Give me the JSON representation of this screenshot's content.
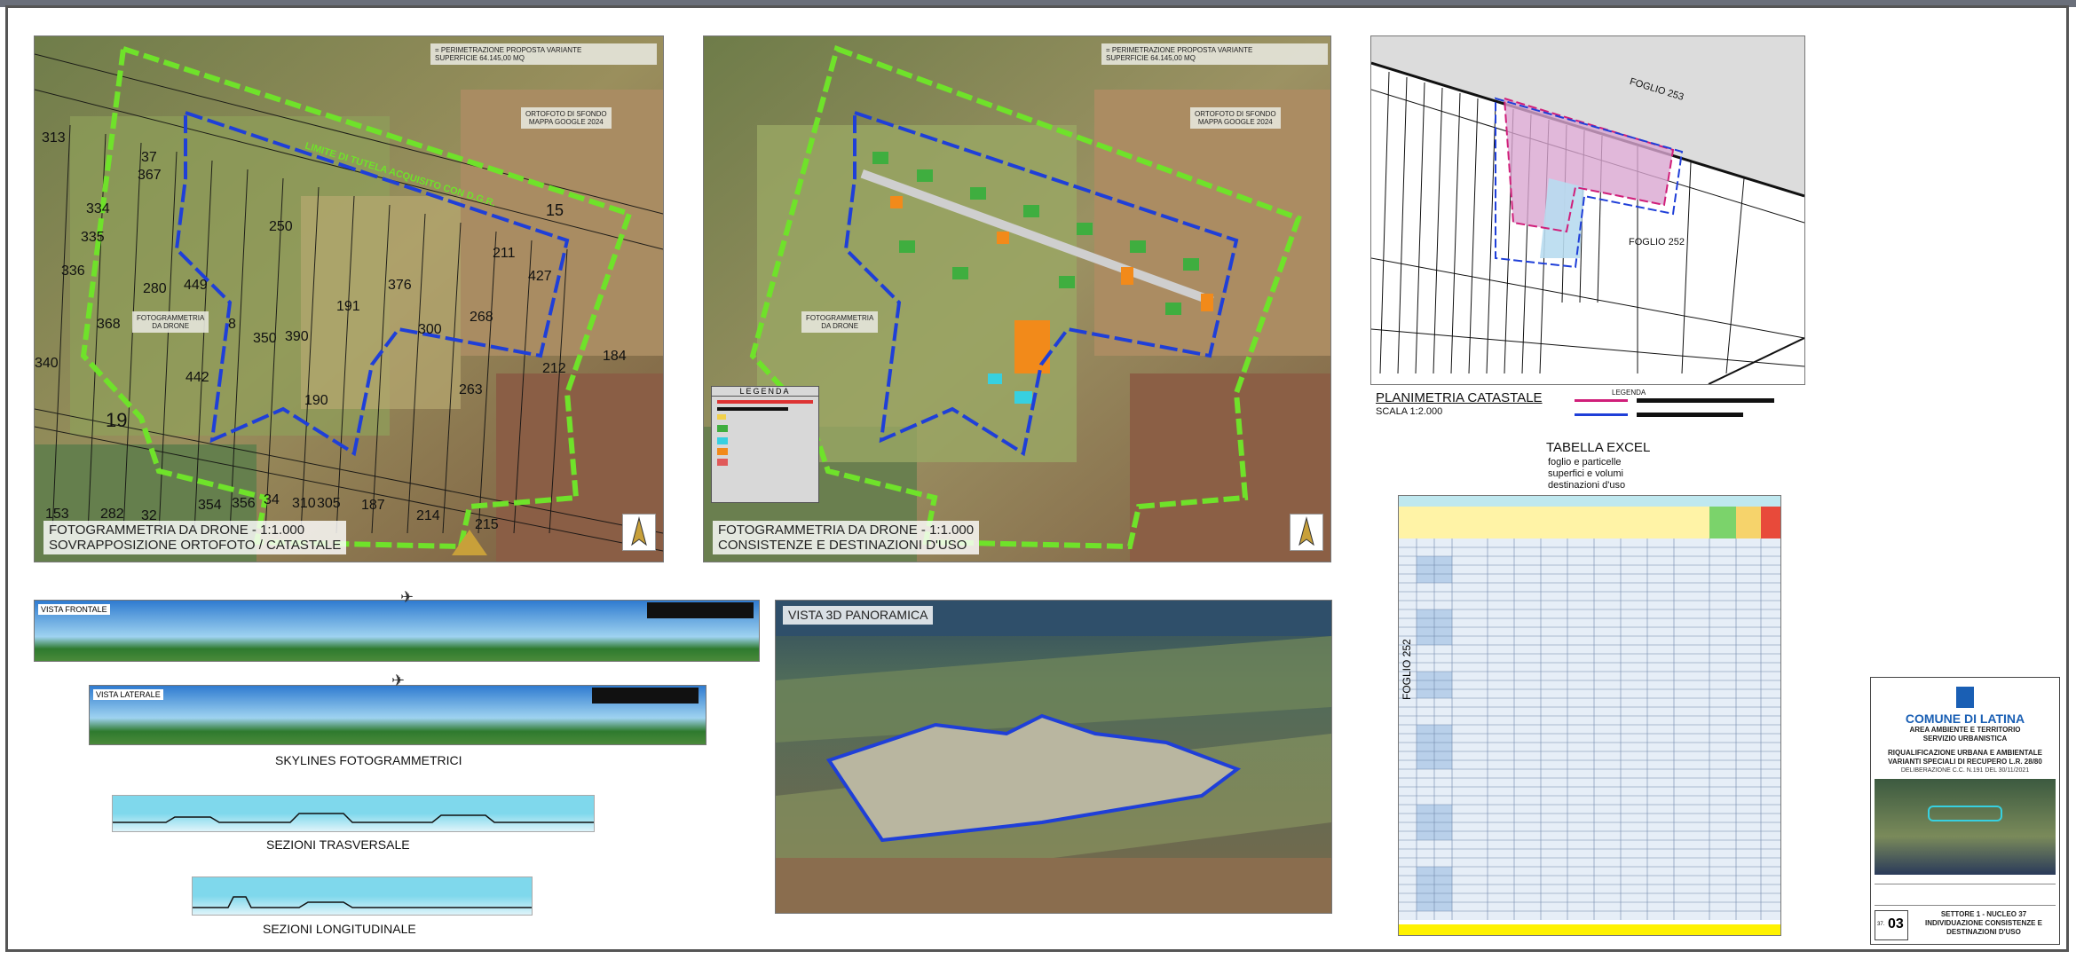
{
  "panels": {
    "map1": {
      "legend_lines": [
        "= PERIMETRAZIONE PROPOSTA VARIANTE",
        "SUPERFICIE 64.145,00 MQ"
      ],
      "ortho_tag": [
        "ORTOFOTO DI SFONDO",
        "MAPPA GOOGLE 2024"
      ],
      "drone_tag": [
        "FOTOGRAMMETRIA",
        "DA DRONE"
      ],
      "caption_line1": "FOTOGRAMMETRIA DA DRONE - 1:1.000",
      "caption_line2": "SOVRAPPOSIZIONE ORTOFOTO / CATASTALE",
      "parcel_numbers": [
        "313",
        "37",
        "367",
        "334",
        "335",
        "336",
        "280",
        "368",
        "340",
        "442",
        "19",
        "8",
        "350",
        "250",
        "376",
        "300",
        "211",
        "427",
        "15",
        "268",
        "184",
        "212",
        "263",
        "215",
        "214",
        "187",
        "305",
        "310",
        "354",
        "356",
        "34",
        "32",
        "153",
        "282",
        "449",
        "390",
        "190",
        "191"
      ],
      "perimeter_text": "LIMITE DI TUTELA ACQUISITO CON D.G.R."
    },
    "map2": {
      "legend_lines": [
        "= PERIMETRAZIONE PROPOSTA VARIANTE",
        "SUPERFICIE 64.145,00 MQ"
      ],
      "ortho_tag": [
        "ORTOFOTO DI SFONDO",
        "MAPPA GOOGLE 2024"
      ],
      "drone_tag": [
        "FOTOGRAMMETRIA",
        "DA DRONE"
      ],
      "legend_title": "LEGENDA",
      "caption_line1": "FOTOGRAMMETRIA DA DRONE - 1:1.000",
      "caption_line2": "CONSISTENZE E DESTINAZIONI D'USO"
    },
    "cadastral": {
      "foglio_253": "FOGLIO 253",
      "foglio_252": "FOGLIO 252",
      "title": "PLANIMETRIA CATASTALE",
      "scale": "SCALA 1:2.000",
      "legend_title": "LEGENDA"
    },
    "excel": {
      "heading": "TABELLA EXCEL",
      "sub1": "foglio e particelle",
      "sub2": "superfici e volumi",
      "sub3": "destinazioni d'uso",
      "side_label": "FOGLIO 252"
    },
    "skylines": {
      "front_label": "VISTA FRONTALE",
      "side_label": "VISTA LATERALE",
      "caption": "SKYLINES FOTOGRAMMETRICI",
      "sez_trasv": "SEZIONI TRASVERSALE",
      "sez_long": "SEZIONI LONGITUDINALE"
    },
    "view3d": {
      "label": "VISTA 3D PANORAMICA"
    }
  },
  "titleblock": {
    "comune": "COMUNE DI LATINA",
    "area1": "AREA AMBIENTE E TERRITORIO",
    "area2": "SERVIZIO URBANISTICA",
    "proj1": "RIQUALIFICAZIONE URBANA E AMBIENTALE",
    "proj2": "VARIANTI SPECIALI DI RECUPERO L.R. 28/80",
    "delib": "DELIBERAZIONE C.C. N.191 DEL 30/11/2021",
    "sheet_num": "03",
    "sheet_pre": "37.",
    "settore": "SETTORE 1 - NUCLEO 37",
    "desc1": "INDIVIDUAZIONE CONSISTENZE E",
    "desc2": "DESTINAZIONI D'USO"
  },
  "colors": {
    "perimeter_green": "#6fe22a",
    "perimeter_blue": "#1f3fd8",
    "brand_blue": "#1a5fb4",
    "sky": "#7fd8ec",
    "table_yellow": "#fff200"
  }
}
